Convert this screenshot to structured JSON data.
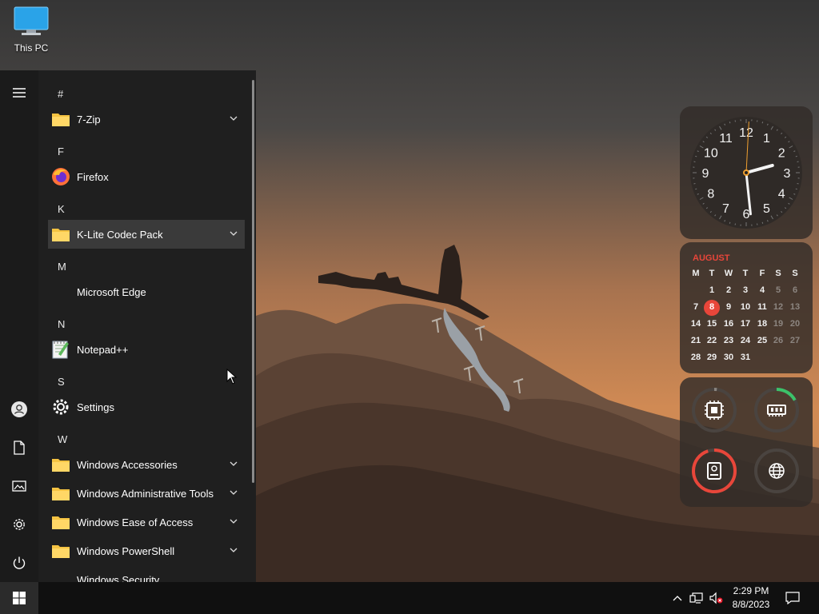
{
  "desktop": {
    "this_pc_label": "This PC"
  },
  "start_menu": {
    "letters": {
      "hash": "#",
      "f": "F",
      "k": "K",
      "m": "M",
      "n": "N",
      "s": "S",
      "w": "W"
    },
    "apps": {
      "seven_zip": "7-Zip",
      "firefox": "Firefox",
      "klite": "K-Lite Codec Pack",
      "edge": "Microsoft Edge",
      "notepadpp": "Notepad++",
      "settings": "Settings",
      "win_accessories": "Windows Accessories",
      "win_admin_tools": "Windows Administrative Tools",
      "win_ease": "Windows Ease of Access",
      "win_powershell": "Windows PowerShell",
      "win_security": "Windows Security"
    },
    "icons": {
      "rail": [
        "hamburger-icon",
        "user-icon",
        "document-icon",
        "pictures-icon",
        "gear-icon",
        "power-icon"
      ],
      "folder_color": "#f5c342"
    }
  },
  "widgets": {
    "clock": {
      "hour_labels": [
        "12",
        "1",
        "2",
        "3",
        "4",
        "5",
        "6",
        "7",
        "8",
        "9",
        "10",
        "11"
      ],
      "time": "2:29"
    },
    "calendar": {
      "month": "AUGUST",
      "weekdays": [
        "M",
        "T",
        "W",
        "T",
        "F",
        "S",
        "S"
      ],
      "weeks": [
        [
          "",
          "1",
          "2",
          "3",
          "4",
          "5",
          "6"
        ],
        [
          "7",
          "8",
          "9",
          "10",
          "11",
          "12",
          "13"
        ],
        [
          "14",
          "15",
          "16",
          "17",
          "18",
          "19",
          "20"
        ],
        [
          "21",
          "22",
          "23",
          "24",
          "25",
          "26",
          "27"
        ],
        [
          "28",
          "29",
          "30",
          "31",
          "",
          "",
          ""
        ]
      ],
      "today": "8",
      "accent": "#e8463a"
    },
    "system_monitor": {
      "cpu_usage": 0.02,
      "memory_usage": 0.17,
      "disk_usage": 0.95,
      "network_usage": 0.0,
      "ram_color": "#3cc26a",
      "disk_color": "#e8463a"
    }
  },
  "taskbar": {
    "time": "2:29 PM",
    "date": "8/8/2023",
    "tray_icons": [
      "chevron-up-icon",
      "network-icon",
      "volume-muted-icon",
      "notification-icon"
    ]
  }
}
